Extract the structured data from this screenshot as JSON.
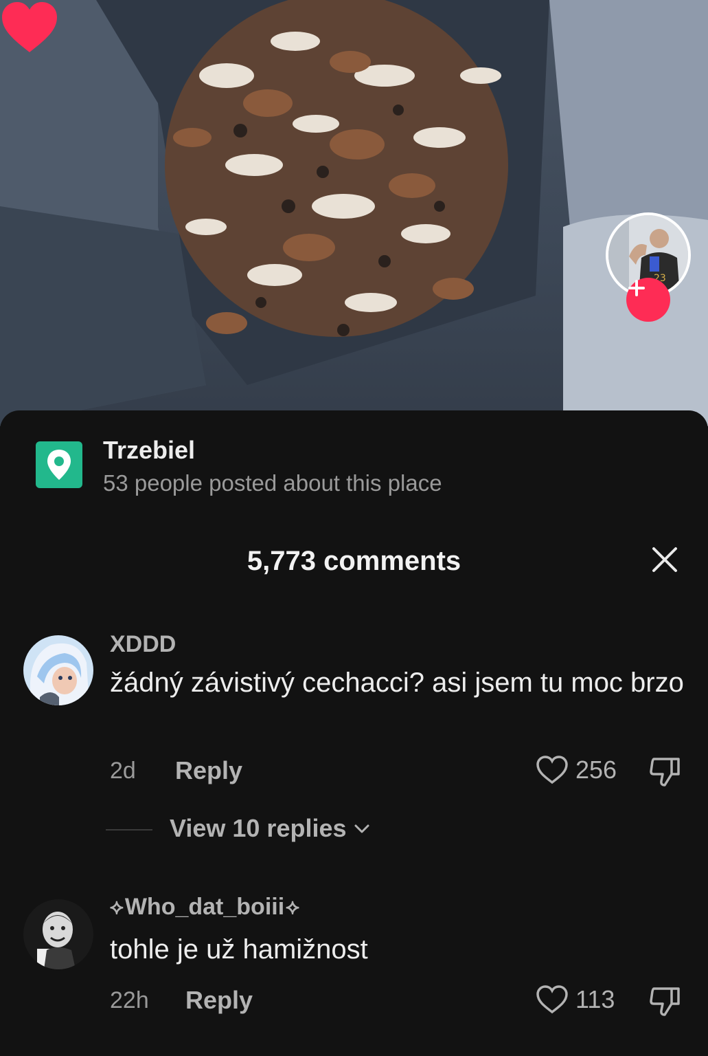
{
  "location": {
    "name": "Trzebiel",
    "subtitle": "53 people posted about this place"
  },
  "comments_header": {
    "title": "5,773 comments"
  },
  "comments": [
    {
      "username": "XDDD",
      "text": "žádný závistivý cechacci? asi jsem tu moc brzo",
      "time": "2d",
      "reply_label": "Reply",
      "likes": "256",
      "view_replies_label": "View 10 replies"
    },
    {
      "username": "Who_dat_boiii",
      "text": "tohle je už hamižnost",
      "time": "22h",
      "reply_label": "Reply",
      "likes": "113"
    }
  ],
  "colors": {
    "background": "#121212",
    "accent_red": "#fe2c55",
    "location_green": "#22b88c"
  },
  "icons": [
    "location-pin-icon",
    "close-icon",
    "heart-outline-icon",
    "dislike-icon",
    "chevron-down-icon",
    "plus-icon",
    "heart-filled-icon"
  ]
}
